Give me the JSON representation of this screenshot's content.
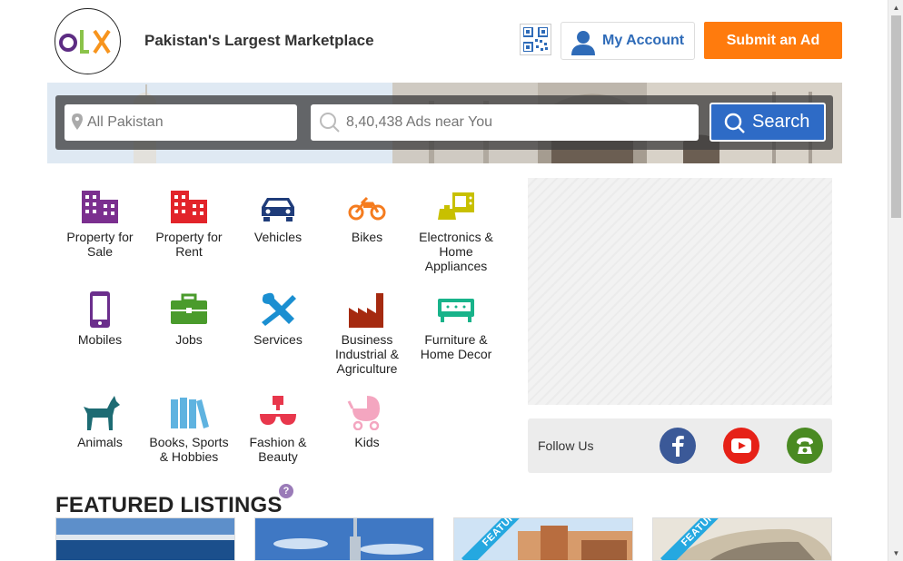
{
  "header": {
    "logo_text": "OLX",
    "tagline": "Pakistan's Largest Marketplace",
    "qr_icon": "qr-code-icon",
    "account_label": "My Account",
    "submit_label": "Submit an Ad"
  },
  "search": {
    "location_placeholder": "All Pakistan",
    "query_placeholder": "8,40,438 Ads near You",
    "button_label": "Search"
  },
  "categories": [
    {
      "label": "Property for Sale",
      "icon": "building-icon",
      "color": "#7b2f8f"
    },
    {
      "label": "Property for Rent",
      "icon": "building-icon",
      "color": "#e2242a"
    },
    {
      "label": "Vehicles",
      "icon": "car-icon",
      "color": "#1f3c7a"
    },
    {
      "label": "Bikes",
      "icon": "motorbike-icon",
      "color": "#f57c1f"
    },
    {
      "label": "Electronics & Home Appliances",
      "icon": "appliance-icon",
      "color": "#c8c000"
    },
    {
      "label": "Mobiles",
      "icon": "mobile-icon",
      "color": "#6b2e8c"
    },
    {
      "label": "Jobs",
      "icon": "briefcase-icon",
      "color": "#4a9b2c"
    },
    {
      "label": "Services",
      "icon": "tools-icon",
      "color": "#1b8fd1"
    },
    {
      "label": "Business Industrial & Agriculture",
      "icon": "factory-icon",
      "color": "#a52a10"
    },
    {
      "label": "Furniture & Home Decor",
      "icon": "sofa-icon",
      "color": "#18b38a"
    },
    {
      "label": "Animals",
      "icon": "dog-icon",
      "color": "#1d6b73"
    },
    {
      "label": "Books, Sports & Hobbies",
      "icon": "books-icon",
      "color": "#5fb3e0"
    },
    {
      "label": "Fashion & Beauty",
      "icon": "fashion-icon",
      "color": "#e8374c"
    },
    {
      "label": "Kids",
      "icon": "pram-icon",
      "color": "#f4a6c0"
    }
  ],
  "sidebar": {
    "follow_label": "Follow Us",
    "socials": [
      {
        "name": "facebook-icon",
        "color": "#3b5998"
      },
      {
        "name": "youtube-icon",
        "color": "#e62117"
      },
      {
        "name": "phone-icon",
        "color": "#4a8a22"
      }
    ]
  },
  "featured": {
    "title": "FEATURED LISTINGS",
    "help": "?",
    "ribbon": "FEATURED"
  }
}
